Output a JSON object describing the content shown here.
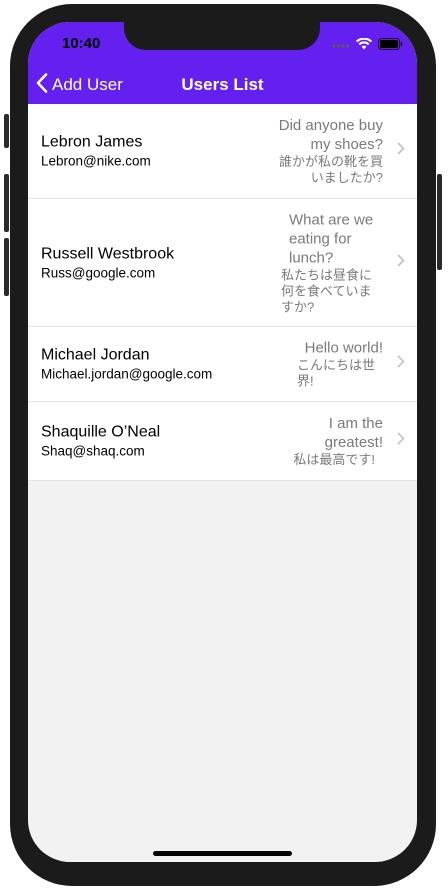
{
  "status_bar": {
    "time": "10:40"
  },
  "nav": {
    "back_label": "Add User",
    "title": "Users List"
  },
  "users": [
    {
      "name": "Lebron James",
      "email": "Lebron@nike.com",
      "message_en": "Did anyone buy my shoes?",
      "message_ja": "誰かが私の靴を買いましたか?"
    },
    {
      "name": "Russell Westbrook",
      "email": "Russ@google.com",
      "message_en": "What are we eating for lunch?",
      "message_ja": "私たちは昼食に何を食べていますか?"
    },
    {
      "name": "Michael Jordan",
      "email": "Michael.jordan@google.com",
      "message_en": "Hello world!",
      "message_ja": "こんにちは世界!"
    },
    {
      "name": "Shaquille O’Neal",
      "email": "Shaq@shaq.com",
      "message_en": "I am the greatest!",
      "message_ja": "私は最高です!"
    }
  ],
  "colors": {
    "nav_background": "#6320ee",
    "list_background": "#ffffff",
    "screen_background": "#f2f2f2"
  }
}
